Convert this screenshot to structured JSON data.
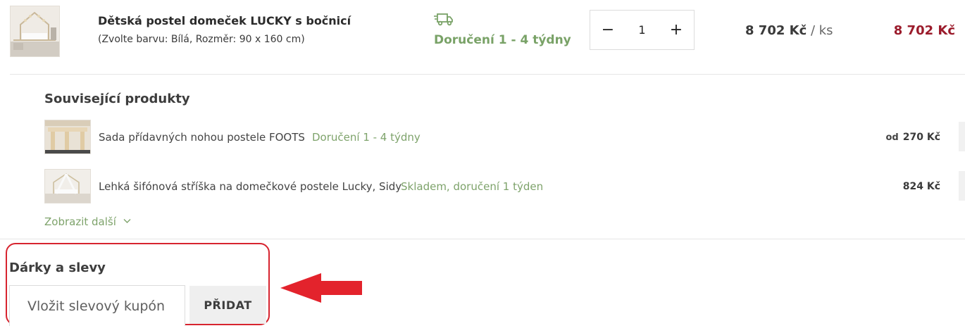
{
  "cart_item": {
    "name": "Dětská postel domeček LUCKY s bočnicí",
    "variant": "(Zvolte barvu: Bílá, Rozměr: 90 x 160 cm)",
    "delivery": "Doručení 1 - 4 týdny",
    "quantity": "1",
    "minus_label": "−",
    "plus_label": "+",
    "unit_price": "8 702 Kč",
    "unit_suffix": " / ks",
    "total_price": "8 702 Kč",
    "delivery_icon": "truck-icon",
    "total_color": "#9b1c2c",
    "delivery_color": "#79a267"
  },
  "related": {
    "title": "Související produkty",
    "items": [
      {
        "name": "Sada přídavných nohou postele FOOTS",
        "delivery": "Doručení 1 - 4 týdny",
        "price_prefix": "od",
        "price": "270 Kč"
      },
      {
        "name": "Lehká šifónová stříška na domečkové postele Lucky, Sidy",
        "delivery": "Skladem, doručení 1 týden",
        "price_prefix": "",
        "price": "824 Kč"
      }
    ],
    "show_more": "Zobrazit další",
    "show_more_icon": "chevron-down-icon"
  },
  "gifts": {
    "title": "Dárky a slevy",
    "coupon_placeholder": "Vložit slevový kupón",
    "add_button": "PŘIDAT",
    "highlight_color": "#d7242f",
    "arrow_icon": "arrow-left-icon"
  }
}
